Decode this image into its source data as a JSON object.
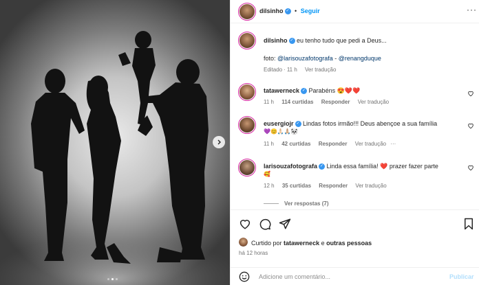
{
  "post": {
    "author": "dilsinho",
    "follow_separator": "•",
    "follow_label": "Seguir",
    "caption_text": "eu tenho tudo que pedi a Deus...",
    "photo_credit_prefix": "foto:",
    "photo_credit_1": "@larisouzafotografa",
    "photo_credit_sep": "-",
    "photo_credit_2": "@renangduque",
    "caption_meta": {
      "edited": "Editado",
      "sep": "·",
      "time": "11 h",
      "translate": "Ver tradução"
    }
  },
  "comments": [
    {
      "user": "tatawerneck",
      "text": "Parabéns",
      "emoji": "😍❤️❤️",
      "time": "11 h",
      "likes": "114 curtidas",
      "reply": "Responder",
      "translate": "Ver tradução"
    },
    {
      "user": "eusergiojr",
      "text": "Lindas fotos irmão!!! Deus abençoe a sua família",
      "emoji_line": "💜😊🙏🏻🙏🏼🐼",
      "time": "11 h",
      "likes": "42 curtidas",
      "reply": "Responder",
      "translate": "Ver tradução",
      "more": "···"
    },
    {
      "user": "larisouzafotografa",
      "text": "Linda essa família!",
      "emoji": "❤️",
      "text2": "prazer fazer parte",
      "emoji_line": "🥰",
      "time": "12 h",
      "likes": "35 curtidas",
      "reply": "Responder",
      "translate": "Ver tradução",
      "replies": "Ver respostas (7)"
    }
  ],
  "likes_line": {
    "prefix": "Curtido por",
    "user": "tatawerneck",
    "conj": "e",
    "others": "outras pessoas"
  },
  "post_time": "há 12 horas",
  "add_comment": {
    "placeholder": "Adicione um comentário...",
    "publish": "Publicar"
  },
  "icons": {
    "heart": "heart-icon",
    "comment": "comment-icon",
    "share": "share-icon",
    "save": "bookmark-icon",
    "emoji": "emoji-icon",
    "next": "chevron-right-icon"
  },
  "carousel": {
    "slides": 3,
    "active": 1
  },
  "colors": {
    "link": "#00376b",
    "follow": "#0095f6",
    "verified": "#3897f0",
    "secondary": "#737373"
  }
}
